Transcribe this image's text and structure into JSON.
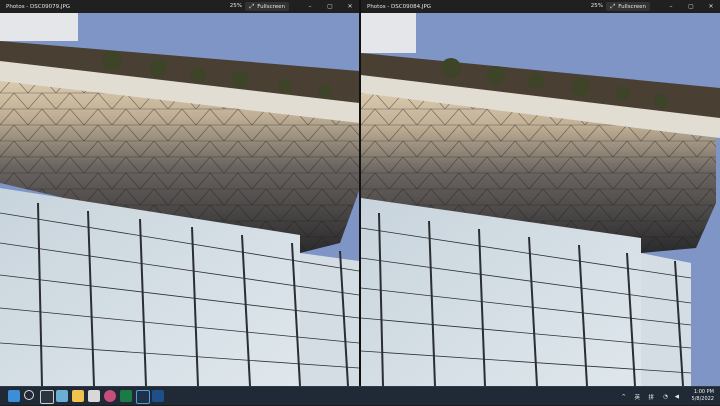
{
  "windows": [
    {
      "title": "Photos - DSC09079.JPG",
      "zoom": "25%",
      "fullscreen_label": "Fullscreen",
      "icons": [
        "fullscreen-icon",
        "minimize-icon",
        "maximize-icon",
        "close-icon"
      ]
    },
    {
      "title": "Photos - DSC09084.JPG",
      "zoom": "25%",
      "fullscreen_label": "Fullscreen",
      "icons": [
        "fullscreen-icon",
        "minimize-icon",
        "maximize-icon",
        "close-icon"
      ]
    }
  ],
  "taskbar": {
    "icons": [
      "windows-start-icon",
      "search-icon",
      "task-view-icon",
      "file-explorer-icon",
      "store-icon",
      "app-icon",
      "edge-icon",
      "excel-icon",
      "terminal-icon",
      "lightroom-icon"
    ],
    "tray_chevron": "^",
    "ime_lang": "英",
    "ime_mode": "拼",
    "time": "1:00 PM",
    "date": "5/8/2022"
  },
  "colors": {
    "sky": "#7e95c6",
    "titlebar": "#202020",
    "taskbar": "#1f2a36"
  }
}
